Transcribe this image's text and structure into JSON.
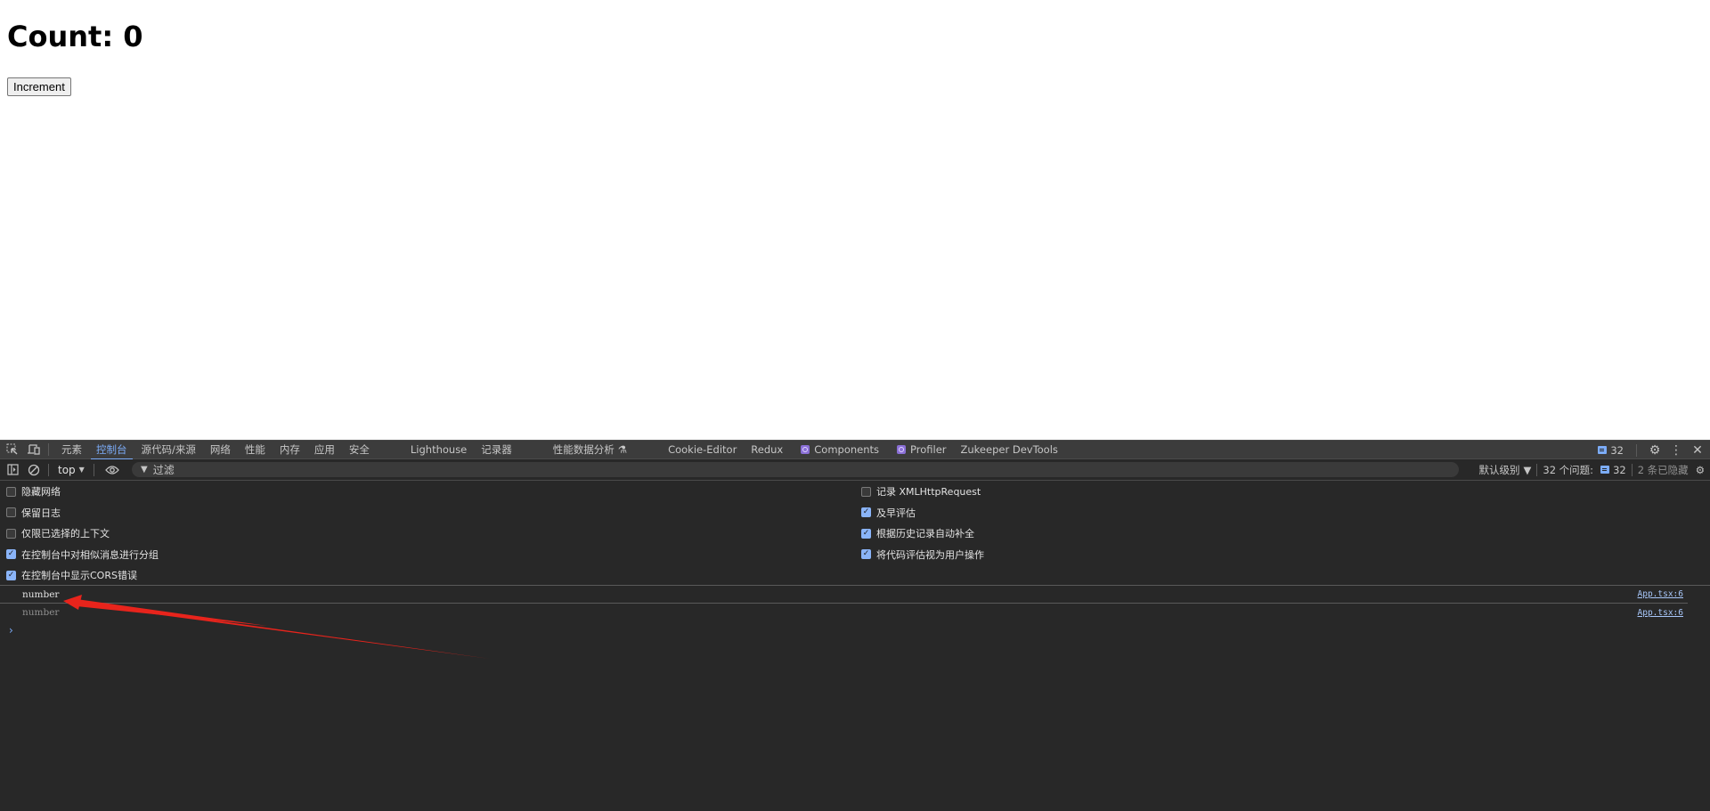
{
  "page": {
    "heading": "Count: 0",
    "increment_label": "Increment"
  },
  "devtools": {
    "tabs": [
      {
        "label": "元素",
        "active": false
      },
      {
        "label": "控制台",
        "active": true
      },
      {
        "label": "源代码/来源",
        "active": false
      },
      {
        "label": "网络",
        "active": false
      },
      {
        "label": "性能",
        "active": false
      },
      {
        "label": "内存",
        "active": false
      },
      {
        "label": "应用",
        "active": false
      },
      {
        "label": "安全",
        "active": false
      },
      {
        "label": "Lighthouse",
        "active": false
      },
      {
        "label": "记录器",
        "active": false
      },
      {
        "label": "性能数据分析",
        "active": false
      },
      {
        "label": "Cookie-Editor",
        "active": false
      },
      {
        "label": "Redux",
        "active": false
      },
      {
        "label": "Components",
        "active": false
      },
      {
        "label": "Profiler",
        "active": false
      },
      {
        "label": "Zukeeper DevTools",
        "active": false
      }
    ],
    "issues_count": "32",
    "toolbar": {
      "context": "top",
      "filter_placeholder": "过滤",
      "level": "默认级别",
      "issues_label": "32 个问题:",
      "issues_count": "32",
      "hidden_label": "2 条已隐藏"
    },
    "settings_left": [
      {
        "label": "隐藏网络",
        "checked": false
      },
      {
        "label": "保留日志",
        "checked": false
      },
      {
        "label": "仅限已选择的上下文",
        "checked": false
      },
      {
        "label": "在控制台中对相似消息进行分组",
        "checked": true
      },
      {
        "label": "在控制台中显示CORS错误",
        "checked": true
      }
    ],
    "settings_right": [
      {
        "label": "记录 XMLHttpRequest",
        "checked": false
      },
      {
        "label": "及早评估",
        "checked": true
      },
      {
        "label": "根据历史记录自动补全",
        "checked": true
      },
      {
        "label": "将代码评估视为用户操作",
        "checked": true
      }
    ],
    "console_messages": [
      {
        "text": "number",
        "source": "App.tsx:6"
      },
      {
        "text": "number",
        "source": "App.tsx:6"
      }
    ],
    "prompt_glyph": "›"
  },
  "annotation": {
    "color": "#e8241c"
  }
}
